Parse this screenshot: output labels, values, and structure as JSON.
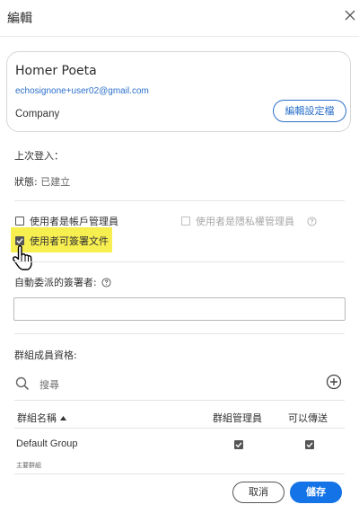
{
  "dialog": {
    "title": "編輯"
  },
  "profile": {
    "name": "Homer Poeta",
    "email": "echosignone+user02@gmail.com",
    "company": "Company",
    "edit_profile_label": "編輯設定檔"
  },
  "info": {
    "last_login_label": "上次登入：",
    "status_label": "狀態:",
    "status_value": "已建立"
  },
  "permissions": {
    "account_admin_label": "使用者是帳戶管理員",
    "account_admin_checked": false,
    "privacy_admin_label": "使用者是隱私權管理員",
    "privacy_admin_checked": false,
    "can_sign_label": "使用者可簽署文件",
    "can_sign_checked": true
  },
  "auto_delegate": {
    "label": "自動委派的簽署者:",
    "value": ""
  },
  "groups": {
    "label": "群組成員資格:",
    "search_placeholder": "搜尋",
    "columns": {
      "name": "群組名稱",
      "admin": "群組管理員",
      "send": "可以傳送"
    },
    "rows": [
      {
        "name": "Default Group",
        "subtitle": "主要群組",
        "is_admin": true,
        "can_send": true
      }
    ]
  },
  "footer": {
    "cancel_label": "取消",
    "save_label": "儲存"
  },
  "colors": {
    "accent": "#1473e6",
    "link": "#2b70c9",
    "highlight": "#f7ee50"
  },
  "icons": {
    "close": "close-icon",
    "help": "help-icon",
    "search": "search-icon",
    "add": "add-circle-icon",
    "cursor": "hand-pointer-icon"
  }
}
